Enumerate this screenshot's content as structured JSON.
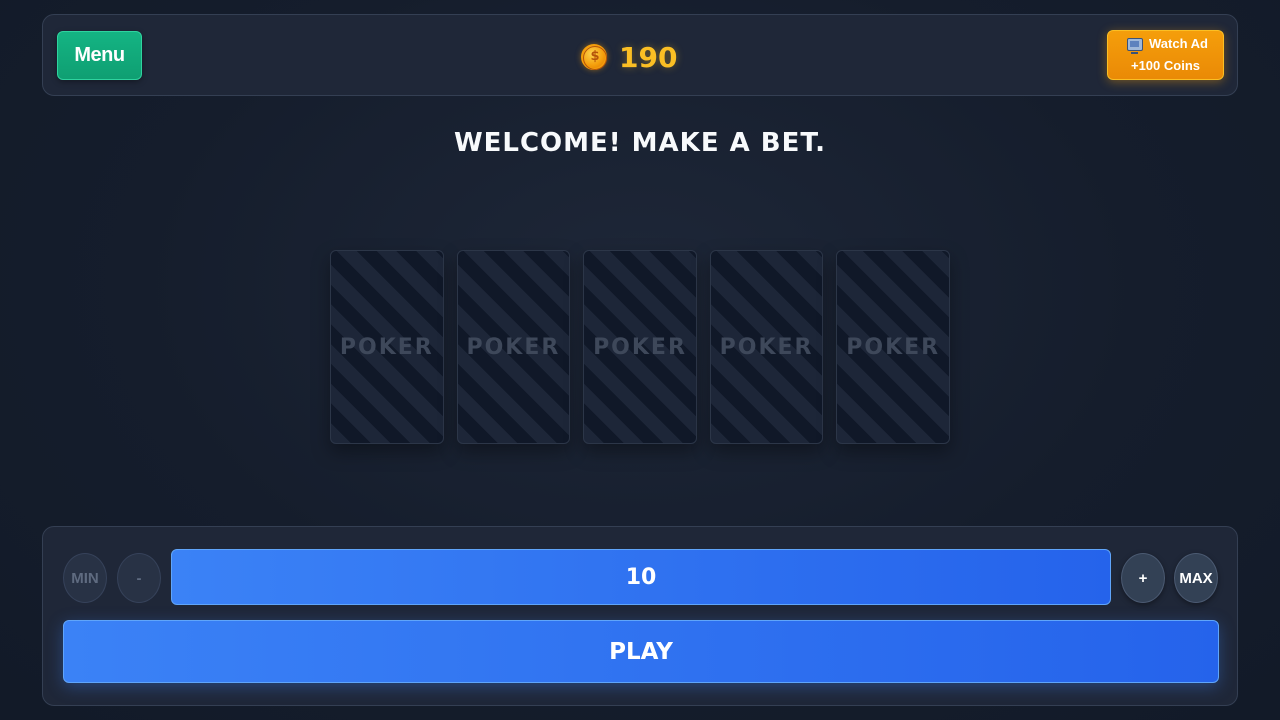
{
  "header": {
    "menu_label": "Menu",
    "coins": "190",
    "coin_icon": "coin-icon",
    "ad_button": {
      "icon": "tv-icon",
      "line1": "Watch Ad",
      "line2": "+100 Coins"
    }
  },
  "status_message": "WELCOME! MAKE A BET.",
  "cards": [
    {
      "label": "POKER"
    },
    {
      "label": "POKER"
    },
    {
      "label": "POKER"
    },
    {
      "label": "POKER"
    },
    {
      "label": "POKER"
    }
  ],
  "bet_controls": {
    "min_label": "MIN",
    "decrease_label": "-",
    "bet_value": "10",
    "increase_label": "+",
    "max_label": "MAX",
    "play_label": "PLAY"
  },
  "colors": {
    "menu_green": "#14b483",
    "coin_gold": "#fbbf24",
    "ad_orange": "#f59e0b",
    "primary_blue": "#3b82f6",
    "panel_bg": "#1f2738"
  }
}
